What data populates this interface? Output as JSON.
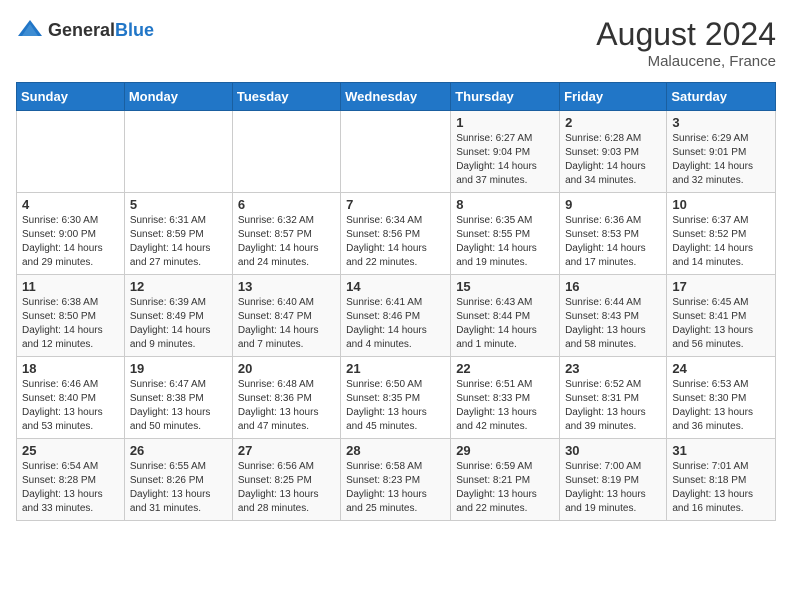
{
  "header": {
    "logo_general": "General",
    "logo_blue": "Blue",
    "month_year": "August 2024",
    "location": "Malaucene, France"
  },
  "days_of_week": [
    "Sunday",
    "Monday",
    "Tuesday",
    "Wednesday",
    "Thursday",
    "Friday",
    "Saturday"
  ],
  "weeks": [
    [
      {
        "day": "",
        "info": ""
      },
      {
        "day": "",
        "info": ""
      },
      {
        "day": "",
        "info": ""
      },
      {
        "day": "",
        "info": ""
      },
      {
        "day": "1",
        "info": "Sunrise: 6:27 AM\nSunset: 9:04 PM\nDaylight: 14 hours and 37 minutes."
      },
      {
        "day": "2",
        "info": "Sunrise: 6:28 AM\nSunset: 9:03 PM\nDaylight: 14 hours and 34 minutes."
      },
      {
        "day": "3",
        "info": "Sunrise: 6:29 AM\nSunset: 9:01 PM\nDaylight: 14 hours and 32 minutes."
      }
    ],
    [
      {
        "day": "4",
        "info": "Sunrise: 6:30 AM\nSunset: 9:00 PM\nDaylight: 14 hours and 29 minutes."
      },
      {
        "day": "5",
        "info": "Sunrise: 6:31 AM\nSunset: 8:59 PM\nDaylight: 14 hours and 27 minutes."
      },
      {
        "day": "6",
        "info": "Sunrise: 6:32 AM\nSunset: 8:57 PM\nDaylight: 14 hours and 24 minutes."
      },
      {
        "day": "7",
        "info": "Sunrise: 6:34 AM\nSunset: 8:56 PM\nDaylight: 14 hours and 22 minutes."
      },
      {
        "day": "8",
        "info": "Sunrise: 6:35 AM\nSunset: 8:55 PM\nDaylight: 14 hours and 19 minutes."
      },
      {
        "day": "9",
        "info": "Sunrise: 6:36 AM\nSunset: 8:53 PM\nDaylight: 14 hours and 17 minutes."
      },
      {
        "day": "10",
        "info": "Sunrise: 6:37 AM\nSunset: 8:52 PM\nDaylight: 14 hours and 14 minutes."
      }
    ],
    [
      {
        "day": "11",
        "info": "Sunrise: 6:38 AM\nSunset: 8:50 PM\nDaylight: 14 hours and 12 minutes."
      },
      {
        "day": "12",
        "info": "Sunrise: 6:39 AM\nSunset: 8:49 PM\nDaylight: 14 hours and 9 minutes."
      },
      {
        "day": "13",
        "info": "Sunrise: 6:40 AM\nSunset: 8:47 PM\nDaylight: 14 hours and 7 minutes."
      },
      {
        "day": "14",
        "info": "Sunrise: 6:41 AM\nSunset: 8:46 PM\nDaylight: 14 hours and 4 minutes."
      },
      {
        "day": "15",
        "info": "Sunrise: 6:43 AM\nSunset: 8:44 PM\nDaylight: 14 hours and 1 minute."
      },
      {
        "day": "16",
        "info": "Sunrise: 6:44 AM\nSunset: 8:43 PM\nDaylight: 13 hours and 58 minutes."
      },
      {
        "day": "17",
        "info": "Sunrise: 6:45 AM\nSunset: 8:41 PM\nDaylight: 13 hours and 56 minutes."
      }
    ],
    [
      {
        "day": "18",
        "info": "Sunrise: 6:46 AM\nSunset: 8:40 PM\nDaylight: 13 hours and 53 minutes."
      },
      {
        "day": "19",
        "info": "Sunrise: 6:47 AM\nSunset: 8:38 PM\nDaylight: 13 hours and 50 minutes."
      },
      {
        "day": "20",
        "info": "Sunrise: 6:48 AM\nSunset: 8:36 PM\nDaylight: 13 hours and 47 minutes."
      },
      {
        "day": "21",
        "info": "Sunrise: 6:50 AM\nSunset: 8:35 PM\nDaylight: 13 hours and 45 minutes."
      },
      {
        "day": "22",
        "info": "Sunrise: 6:51 AM\nSunset: 8:33 PM\nDaylight: 13 hours and 42 minutes."
      },
      {
        "day": "23",
        "info": "Sunrise: 6:52 AM\nSunset: 8:31 PM\nDaylight: 13 hours and 39 minutes."
      },
      {
        "day": "24",
        "info": "Sunrise: 6:53 AM\nSunset: 8:30 PM\nDaylight: 13 hours and 36 minutes."
      }
    ],
    [
      {
        "day": "25",
        "info": "Sunrise: 6:54 AM\nSunset: 8:28 PM\nDaylight: 13 hours and 33 minutes."
      },
      {
        "day": "26",
        "info": "Sunrise: 6:55 AM\nSunset: 8:26 PM\nDaylight: 13 hours and 31 minutes."
      },
      {
        "day": "27",
        "info": "Sunrise: 6:56 AM\nSunset: 8:25 PM\nDaylight: 13 hours and 28 minutes."
      },
      {
        "day": "28",
        "info": "Sunrise: 6:58 AM\nSunset: 8:23 PM\nDaylight: 13 hours and 25 minutes."
      },
      {
        "day": "29",
        "info": "Sunrise: 6:59 AM\nSunset: 8:21 PM\nDaylight: 13 hours and 22 minutes."
      },
      {
        "day": "30",
        "info": "Sunrise: 7:00 AM\nSunset: 8:19 PM\nDaylight: 13 hours and 19 minutes."
      },
      {
        "day": "31",
        "info": "Sunrise: 7:01 AM\nSunset: 8:18 PM\nDaylight: 13 hours and 16 minutes."
      }
    ]
  ]
}
